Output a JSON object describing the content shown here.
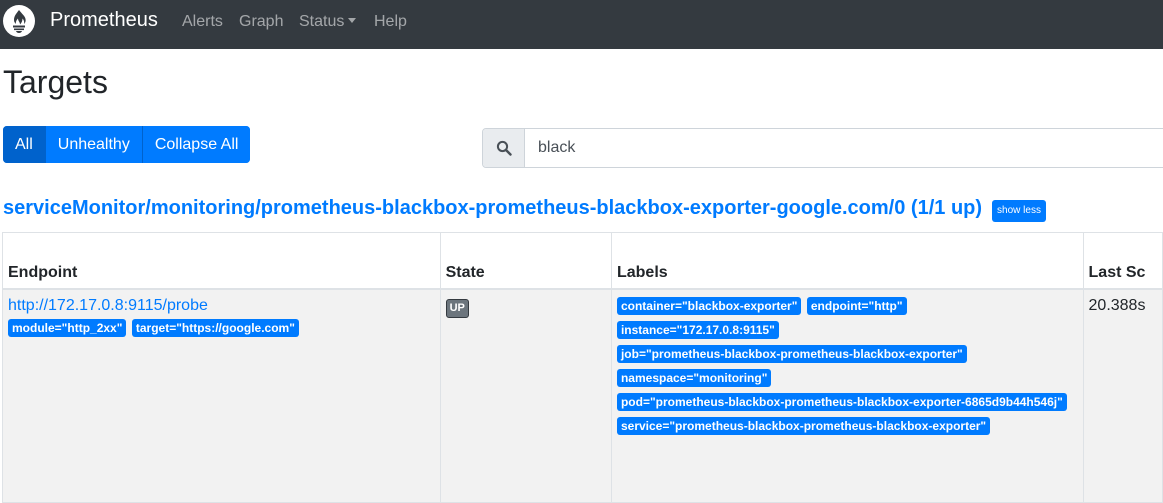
{
  "navbar": {
    "brand": "Prometheus",
    "links": [
      "Alerts",
      "Graph",
      "Status",
      "Help"
    ],
    "logo_icon": "prometheus-flame-icon"
  },
  "page": {
    "title": "Targets"
  },
  "filters": {
    "all": "All",
    "unhealthy": "Unhealthy",
    "collapse": "Collapse All"
  },
  "search": {
    "value": "black",
    "icon": "search-icon"
  },
  "group": {
    "heading": "serviceMonitor/monitoring/prometheus-blackbox-prometheus-blackbox-exporter-google.com/0 (1/1 up)",
    "toggle_label": "show less"
  },
  "table": {
    "headers": {
      "endpoint": "Endpoint",
      "state": "State",
      "labels": "Labels",
      "last_scrape": "Last Sc"
    },
    "row": {
      "endpoint_url": "http://172.17.0.8:9115/probe",
      "endpoint_params": [
        "module=\"http_2xx\"",
        "target=\"https://google.com\""
      ],
      "state": "UP",
      "labels": [
        [
          "container=\"blackbox-exporter\"",
          "endpoint=\"http\""
        ],
        [
          "instance=\"172.17.0.8:9115\""
        ],
        [
          "job=\"prometheus-blackbox-prometheus-blackbox-exporter\""
        ],
        [
          "namespace=\"monitoring\""
        ],
        [
          "pod=\"prometheus-blackbox-prometheus-blackbox-exporter-6865d9b44h546j\""
        ],
        [
          "service=\"prometheus-blackbox-prometheus-blackbox-exporter\""
        ]
      ],
      "last_scrape": "20.388s"
    }
  },
  "colors": {
    "navbar": "#343a40",
    "primary": "#007bff",
    "row_bg": "#f2f2f2"
  }
}
